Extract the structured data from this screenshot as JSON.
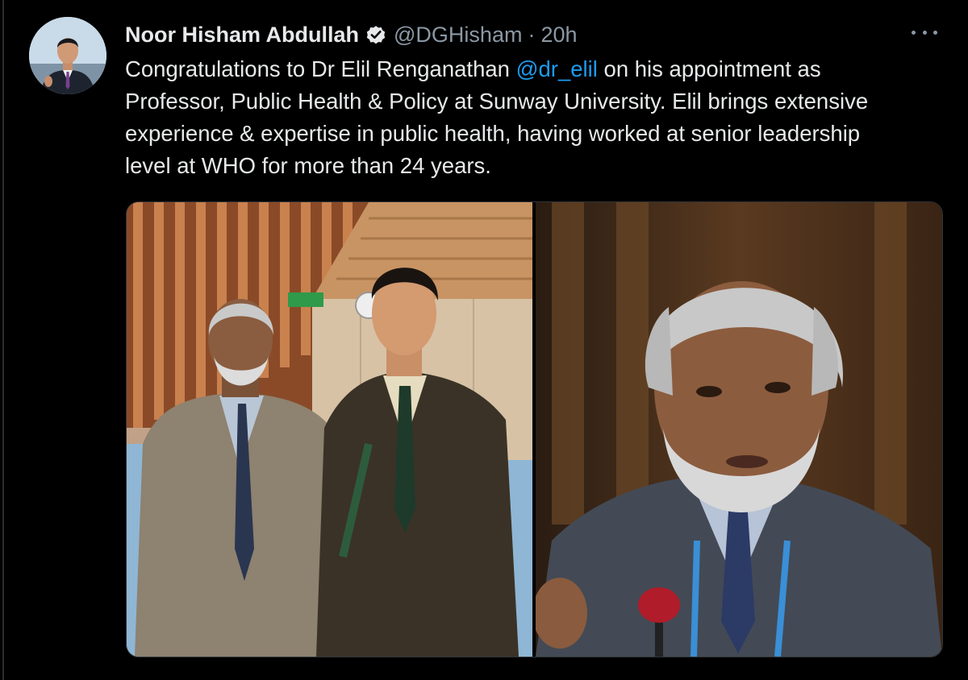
{
  "tweet": {
    "author": {
      "display_name": "Noor Hisham Abdullah",
      "handle": "@DGHisham",
      "verified": true,
      "avatar_icon": "profile-photo"
    },
    "separator": "·",
    "timestamp": "20h",
    "more_icon": "more-horizontal-icon",
    "text": {
      "line1_before": "Congratulations to Dr Elil Renganathan ",
      "mention": "@dr_elil",
      "line1_after": " on his appointment as",
      "line2": "Professor, Public Health & Policy at Sunway University. Elil brings extensive",
      "line3": "experience & expertise in public health, having worked at senior leadership",
      "line4": "level at WHO for more than 24 years."
    },
    "media": {
      "count": 2
    }
  },
  "colors": {
    "background": "#000000",
    "text_primary": "#e7e9ea",
    "text_secondary": "#8b98a5",
    "link": "#1d9bf0"
  }
}
